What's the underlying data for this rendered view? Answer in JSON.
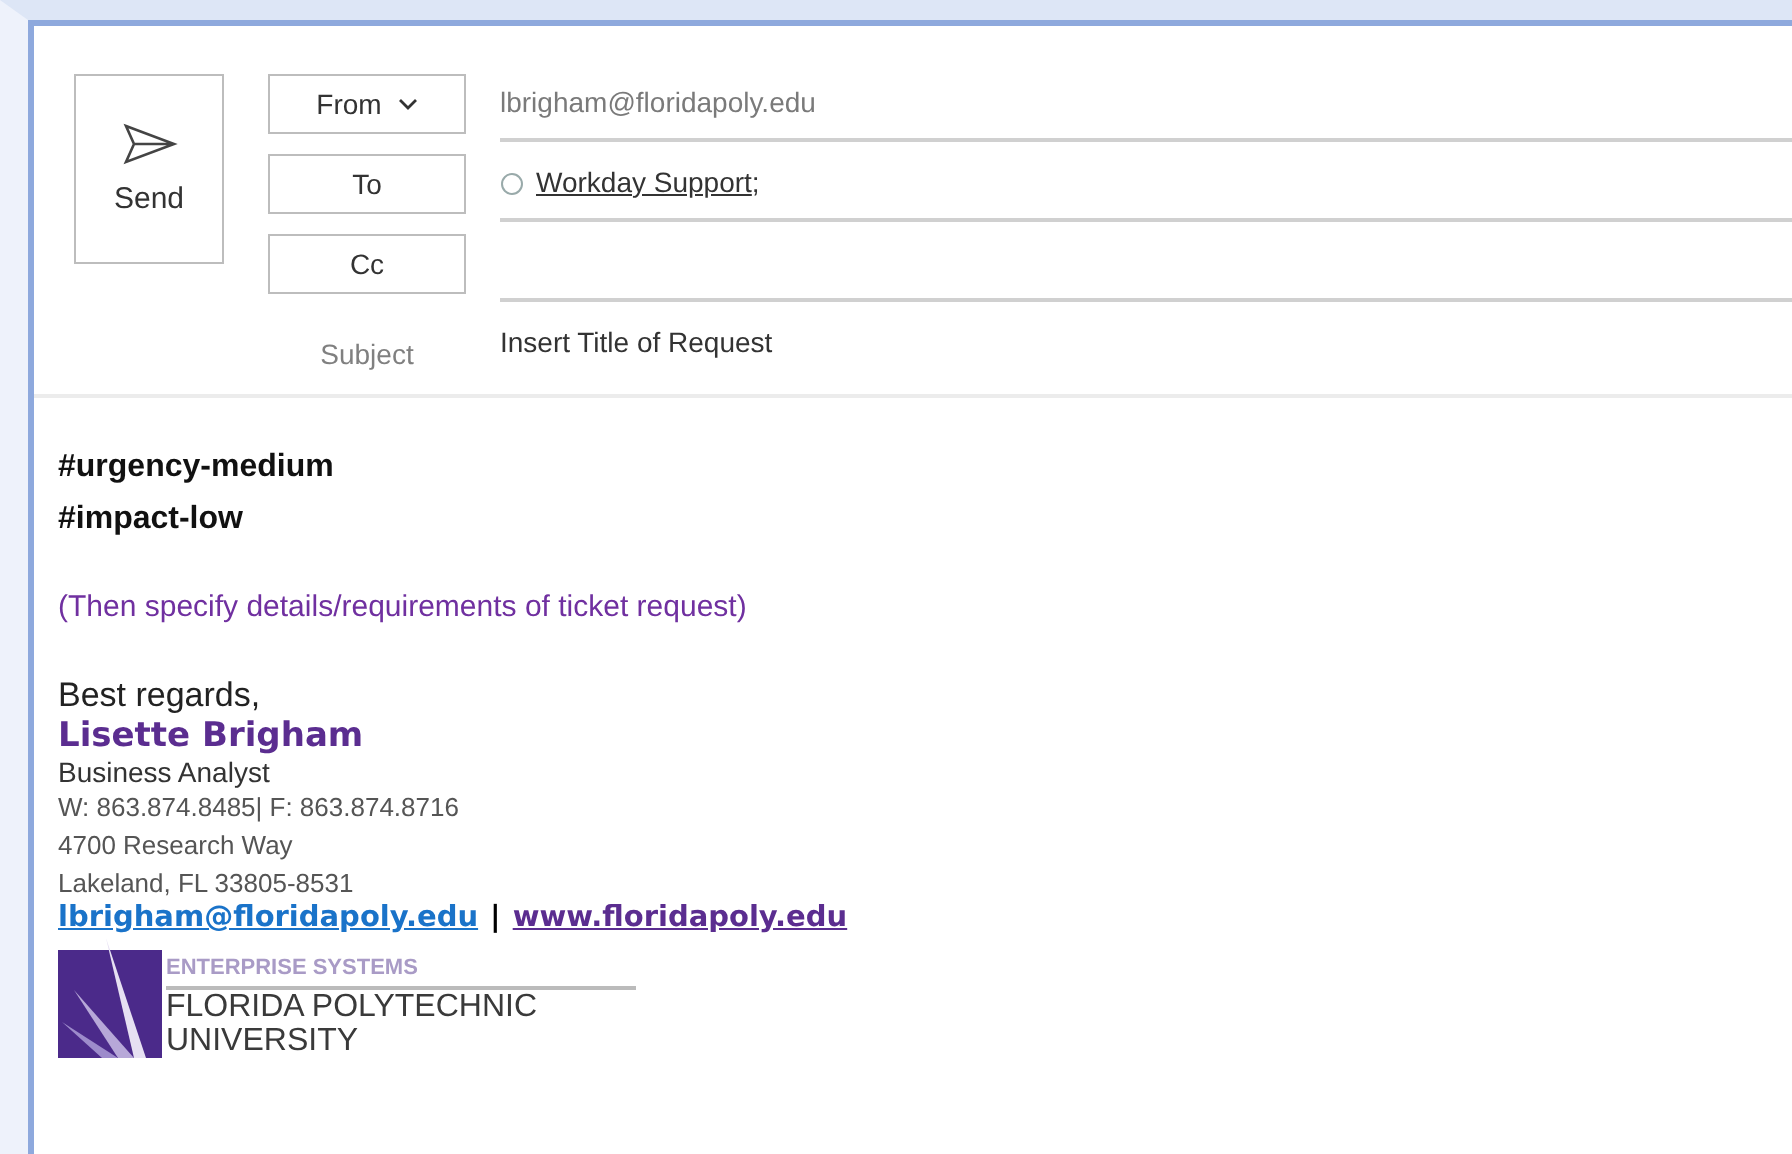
{
  "send_button": {
    "label": "Send"
  },
  "header_rows": [
    {
      "kind": "button",
      "label": "From",
      "dropdown": true,
      "value": "lbrigham@floridapoly.edu"
    },
    {
      "kind": "button",
      "label": "To",
      "dropdown": false,
      "recipients": [
        {
          "name": "Workday Support",
          "separator": ";"
        }
      ]
    },
    {
      "kind": "button",
      "label": "Cc",
      "dropdown": false
    },
    {
      "kind": "label",
      "label": "Subject",
      "value": "Insert Title of Request"
    }
  ],
  "body": {
    "tags": [
      "#urgency-medium",
      "#impact-low"
    ],
    "instruction": "(Then specify details/requirements of ticket request)",
    "closing": "Best regards,",
    "signature": {
      "name": "Lisette Brigham",
      "title": "Business Analyst",
      "phone": "W: 863.874.8485| F: 863.874.8716",
      "address_lines": [
        "4700 Research Way",
        "Lakeland, FL 33805-8531"
      ],
      "email_link": "lbrigham@floridapoly.edu",
      "separator": "|",
      "web_link": "www.floridapoly.edu",
      "logo": {
        "department": "ENTERPRISE SYSTEMS",
        "name_lines": [
          "FLORIDA POLYTECHNIC",
          "UNIVERSITY"
        ]
      }
    }
  }
}
